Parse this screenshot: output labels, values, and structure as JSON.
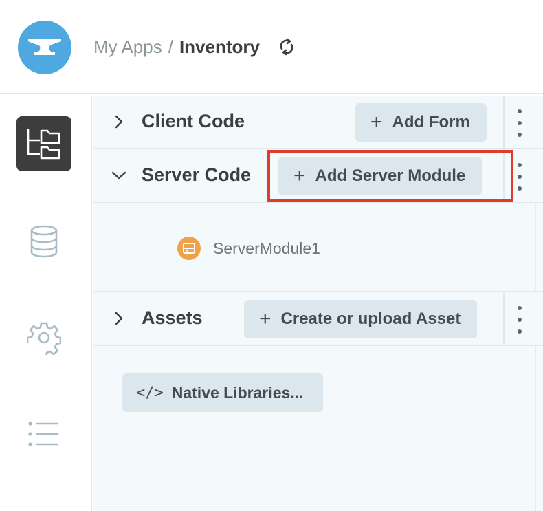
{
  "header": {
    "breadcrumb_parent": "My Apps",
    "breadcrumb_separator": "/",
    "breadcrumb_current": "Inventory",
    "logo_icon": "anvil-icon",
    "refresh_icon": "refresh-icon"
  },
  "sidebar": {
    "items": [
      {
        "name": "code-files",
        "icon": "folder-tree-icon",
        "active": true
      },
      {
        "name": "data-tables",
        "icon": "database-icon",
        "active": false
      },
      {
        "name": "settings",
        "icon": "gear-icon",
        "active": false
      },
      {
        "name": "list",
        "icon": "list-icon",
        "active": false
      }
    ]
  },
  "sections": {
    "client": {
      "title": "Client Code",
      "button": "Add Form",
      "expanded": false
    },
    "server": {
      "title": "Server Code",
      "button": "Add Server Module",
      "expanded": true
    },
    "assets": {
      "title": "Assets",
      "button": "Create or upload Asset",
      "expanded": false
    }
  },
  "server_modules": [
    {
      "label": "ServerModule1",
      "icon": "server-module-icon"
    }
  ],
  "native_libraries": {
    "glyph": "</>",
    "label": "Native Libraries..."
  },
  "colors": {
    "logo_blue": "#4fa9e0",
    "highlight_red": "#e03c2c",
    "module_orange": "#f0a24a",
    "button_bg": "#dbe7ec",
    "panel_bg": "#f4f9fb"
  }
}
